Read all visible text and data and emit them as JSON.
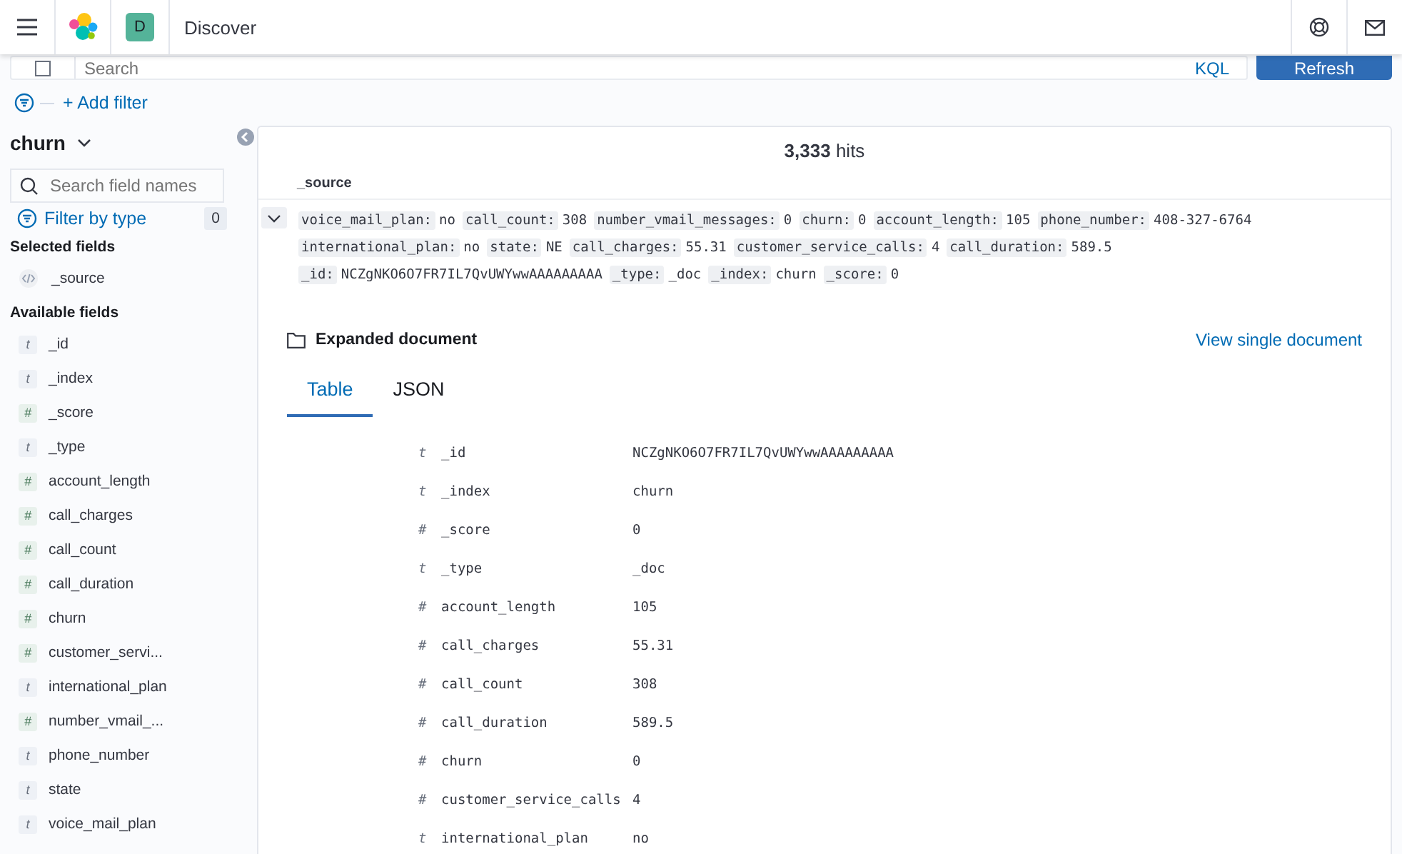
{
  "header": {
    "avatar": "D",
    "title": "Discover"
  },
  "query": {
    "placeholder": "Search",
    "language": "KQL",
    "refresh": "Refresh"
  },
  "filters": {
    "add": "+ Add filter"
  },
  "sidebar": {
    "index": "churn",
    "search_placeholder": "Search field names",
    "filter_by_type": "Filter by type",
    "filter_count": "0",
    "selected_heading": "Selected fields",
    "selected_fields": [
      {
        "name": "_source",
        "kind": "source"
      }
    ],
    "available_heading": "Available fields",
    "available_fields": [
      {
        "name": "_id",
        "kind": "string",
        "glyph": "t"
      },
      {
        "name": "_index",
        "kind": "string",
        "glyph": "t"
      },
      {
        "name": "_score",
        "kind": "number",
        "glyph": "#"
      },
      {
        "name": "_type",
        "kind": "string",
        "glyph": "t"
      },
      {
        "name": "account_length",
        "kind": "number",
        "glyph": "#"
      },
      {
        "name": "call_charges",
        "kind": "number",
        "glyph": "#"
      },
      {
        "name": "call_count",
        "kind": "number",
        "glyph": "#"
      },
      {
        "name": "call_duration",
        "kind": "number",
        "glyph": "#"
      },
      {
        "name": "churn",
        "kind": "number",
        "glyph": "#"
      },
      {
        "name": "customer_servi...",
        "kind": "number",
        "glyph": "#"
      },
      {
        "name": "international_plan",
        "kind": "string",
        "glyph": "t"
      },
      {
        "name": "number_vmail_...",
        "kind": "number",
        "glyph": "#"
      },
      {
        "name": "phone_number",
        "kind": "string",
        "glyph": "t"
      },
      {
        "name": "state",
        "kind": "string",
        "glyph": "t"
      },
      {
        "name": "voice_mail_plan",
        "kind": "string",
        "glyph": "t"
      }
    ]
  },
  "results": {
    "hits": "**3,333** hits",
    "column": "_source",
    "row": {
      "expanded": true,
      "lines": [
        [
          {
            "key": "voice_mail_plan:",
            "value": "no"
          },
          {
            "key": "call_count:",
            "value": "308"
          },
          {
            "key": "number_vmail_messages:",
            "value": "0"
          },
          {
            "key": "churn:",
            "value": "0"
          },
          {
            "key": "account_length:",
            "value": "105"
          },
          {
            "key": "phone_number:",
            "value": "408-327-6764"
          }
        ],
        [
          {
            "key": "international_plan:",
            "value": "no"
          },
          {
            "key": "state:",
            "value": "NE"
          },
          {
            "key": "call_charges:",
            "value": "55.31"
          },
          {
            "key": "customer_service_calls:",
            "value": "4"
          },
          {
            "key": "call_duration:",
            "value": "589.5"
          }
        ],
        [
          {
            "key": "_id:",
            "value": "NCZgNKO6O7FR7IL7QvUWYwwAAAAAAAAA"
          },
          {
            "key": "_type:",
            "value": "_doc"
          },
          {
            "key": "_index:",
            "value": "churn"
          },
          {
            "key": "_score:",
            "value": "0"
          }
        ]
      ]
    },
    "expanded_title": "Expanded document",
    "view_single": "View single document",
    "tabs": [
      {
        "label": "Table",
        "selected": true
      },
      {
        "label": "JSON",
        "selected": false
      }
    ],
    "fields": [
      {
        "glyph": "t",
        "name": "_id",
        "value": "NCZgNKO6O7FR7IL7QvUWYwwAAAAAAAAA"
      },
      {
        "glyph": "t",
        "name": "_index",
        "value": "churn"
      },
      {
        "glyph": "#",
        "name": "_score",
        "value": "0"
      },
      {
        "glyph": "t",
        "name": "_type",
        "value": "_doc"
      },
      {
        "glyph": "#",
        "name": "account_length",
        "value": "105"
      },
      {
        "glyph": "#",
        "name": "call_charges",
        "value": "55.31"
      },
      {
        "glyph": "#",
        "name": "call_count",
        "value": "308"
      },
      {
        "glyph": "#",
        "name": "call_duration",
        "value": "589.5"
      },
      {
        "glyph": "#",
        "name": "churn",
        "value": "0"
      },
      {
        "glyph": "#",
        "name": "customer_service_calls",
        "value": "4"
      },
      {
        "glyph": "t",
        "name": "international_plan",
        "value": "no"
      }
    ]
  }
}
